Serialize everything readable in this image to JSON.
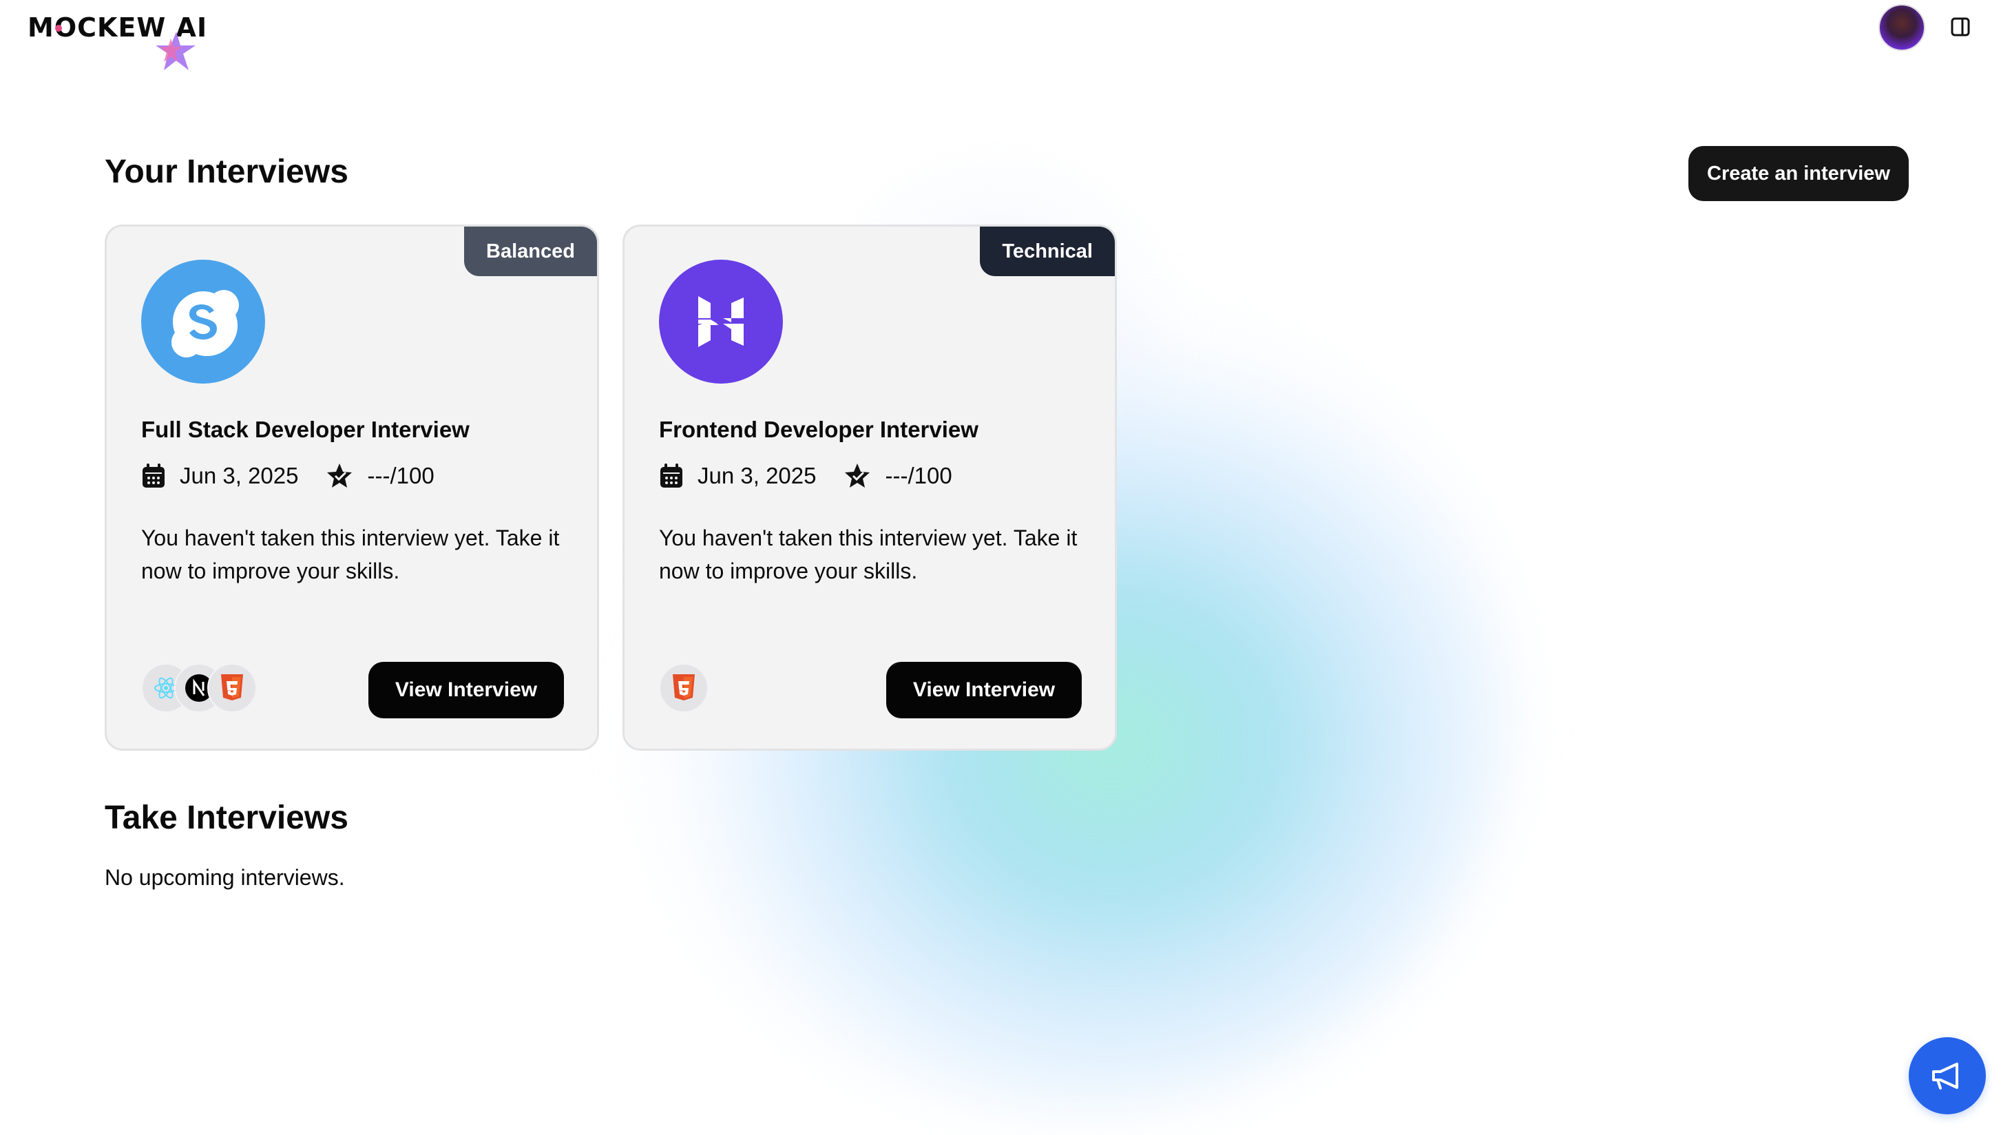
{
  "header": {
    "logo_text": "MOCKEW AI",
    "user_avatar_icon": "user-avatar",
    "sidebar_toggle_icon": "sidebar-toggle-icon"
  },
  "interviews": {
    "title": "Your Interviews",
    "create_label": "Create an interview",
    "cards": [
      {
        "badge": "Balanced",
        "logo_icon": "skype-logo-icon",
        "logo_color": "#4ba3eb",
        "title": "Full Stack Developer Interview",
        "date": "Jun 3, 2025",
        "score": "---/100",
        "description": "You haven't taken this interview yet. Take it now to improve your skills.",
        "techs": [
          "react-icon",
          "nextjs-icon",
          "html5-icon"
        ],
        "button": "View Interview"
      },
      {
        "badge": "Technical",
        "logo_icon": "hostinger-logo-icon",
        "logo_color": "#673de6",
        "title": "Frontend Developer Interview",
        "date": "Jun 3, 2025",
        "score": "---/100",
        "description": "You haven't taken this interview yet. Take it now to improve your skills.",
        "techs": [
          "html5-icon"
        ],
        "button": "View Interview"
      }
    ]
  },
  "take": {
    "title": "Take Interviews",
    "empty": "No upcoming interviews."
  },
  "colors": {
    "accent_fab": "#2563eb",
    "badge_balanced": "#4a5261",
    "badge_technical": "#1d2433"
  }
}
